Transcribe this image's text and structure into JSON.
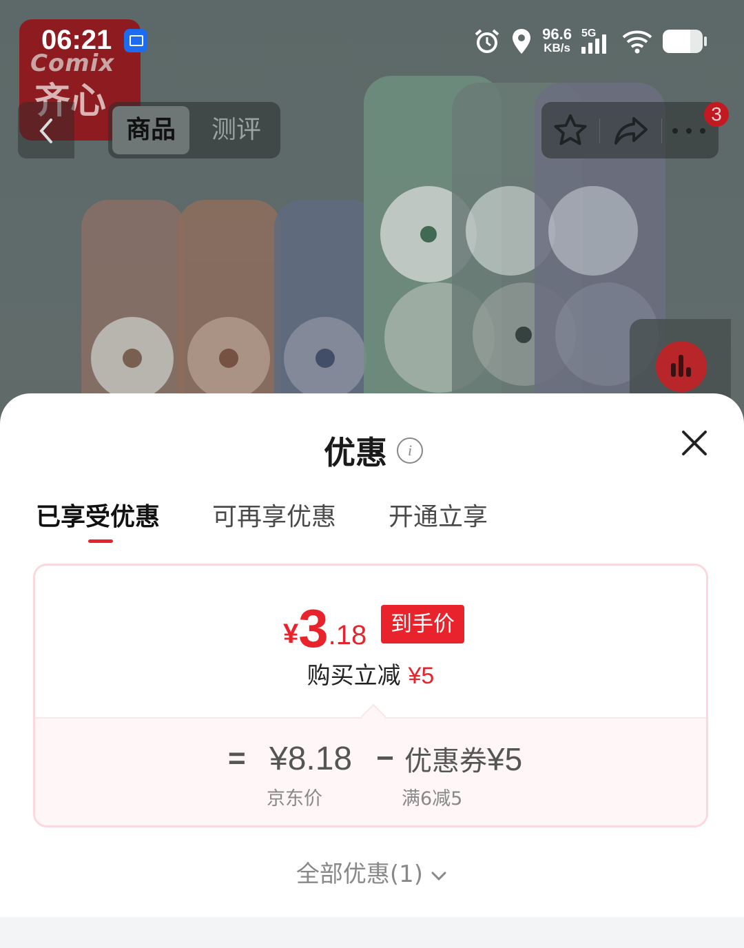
{
  "status_bar": {
    "time": "06:21",
    "network_speed_value": "96.6",
    "network_speed_unit": "KB/s",
    "network_type": "5G",
    "icons": [
      "screen-cast-icon",
      "alarm-icon",
      "location-icon",
      "signal-icon",
      "wifi-icon",
      "battery-icon"
    ]
  },
  "brand_logo": {
    "text_top": "Comix",
    "text_bottom": "齐心"
  },
  "top_nav": {
    "tabs": [
      {
        "label": "商品",
        "active": true
      },
      {
        "label": "测评",
        "active": false
      }
    ],
    "icons": [
      "back-arrow-icon",
      "star-icon",
      "share-icon",
      "more-icon"
    ],
    "notification_count": "3"
  },
  "sheet": {
    "title": "优惠",
    "offer_tabs": [
      {
        "label": "已享受优惠",
        "active": true
      },
      {
        "label": "可再享优惠",
        "active": false
      },
      {
        "label": "开通立享",
        "active": false
      }
    ],
    "final_price": {
      "yen": "¥",
      "int": "3",
      "dec": ".18",
      "tag": "到手价"
    },
    "reduce_text": "购买立减",
    "reduce_amount": "¥5",
    "breakdown": {
      "equals": "=",
      "jd_price": "¥8.18",
      "jd_price_label": "京东价",
      "minus": "−",
      "coupon_label": "优惠券",
      "coupon_value": "¥5",
      "coupon_rule": "满6减5"
    },
    "all_offers_label": "全部优惠(1)"
  },
  "colors": {
    "accent": "#e9232b",
    "card_border": "#fbd8de",
    "card_bottom_bg": "#fff6f7"
  }
}
